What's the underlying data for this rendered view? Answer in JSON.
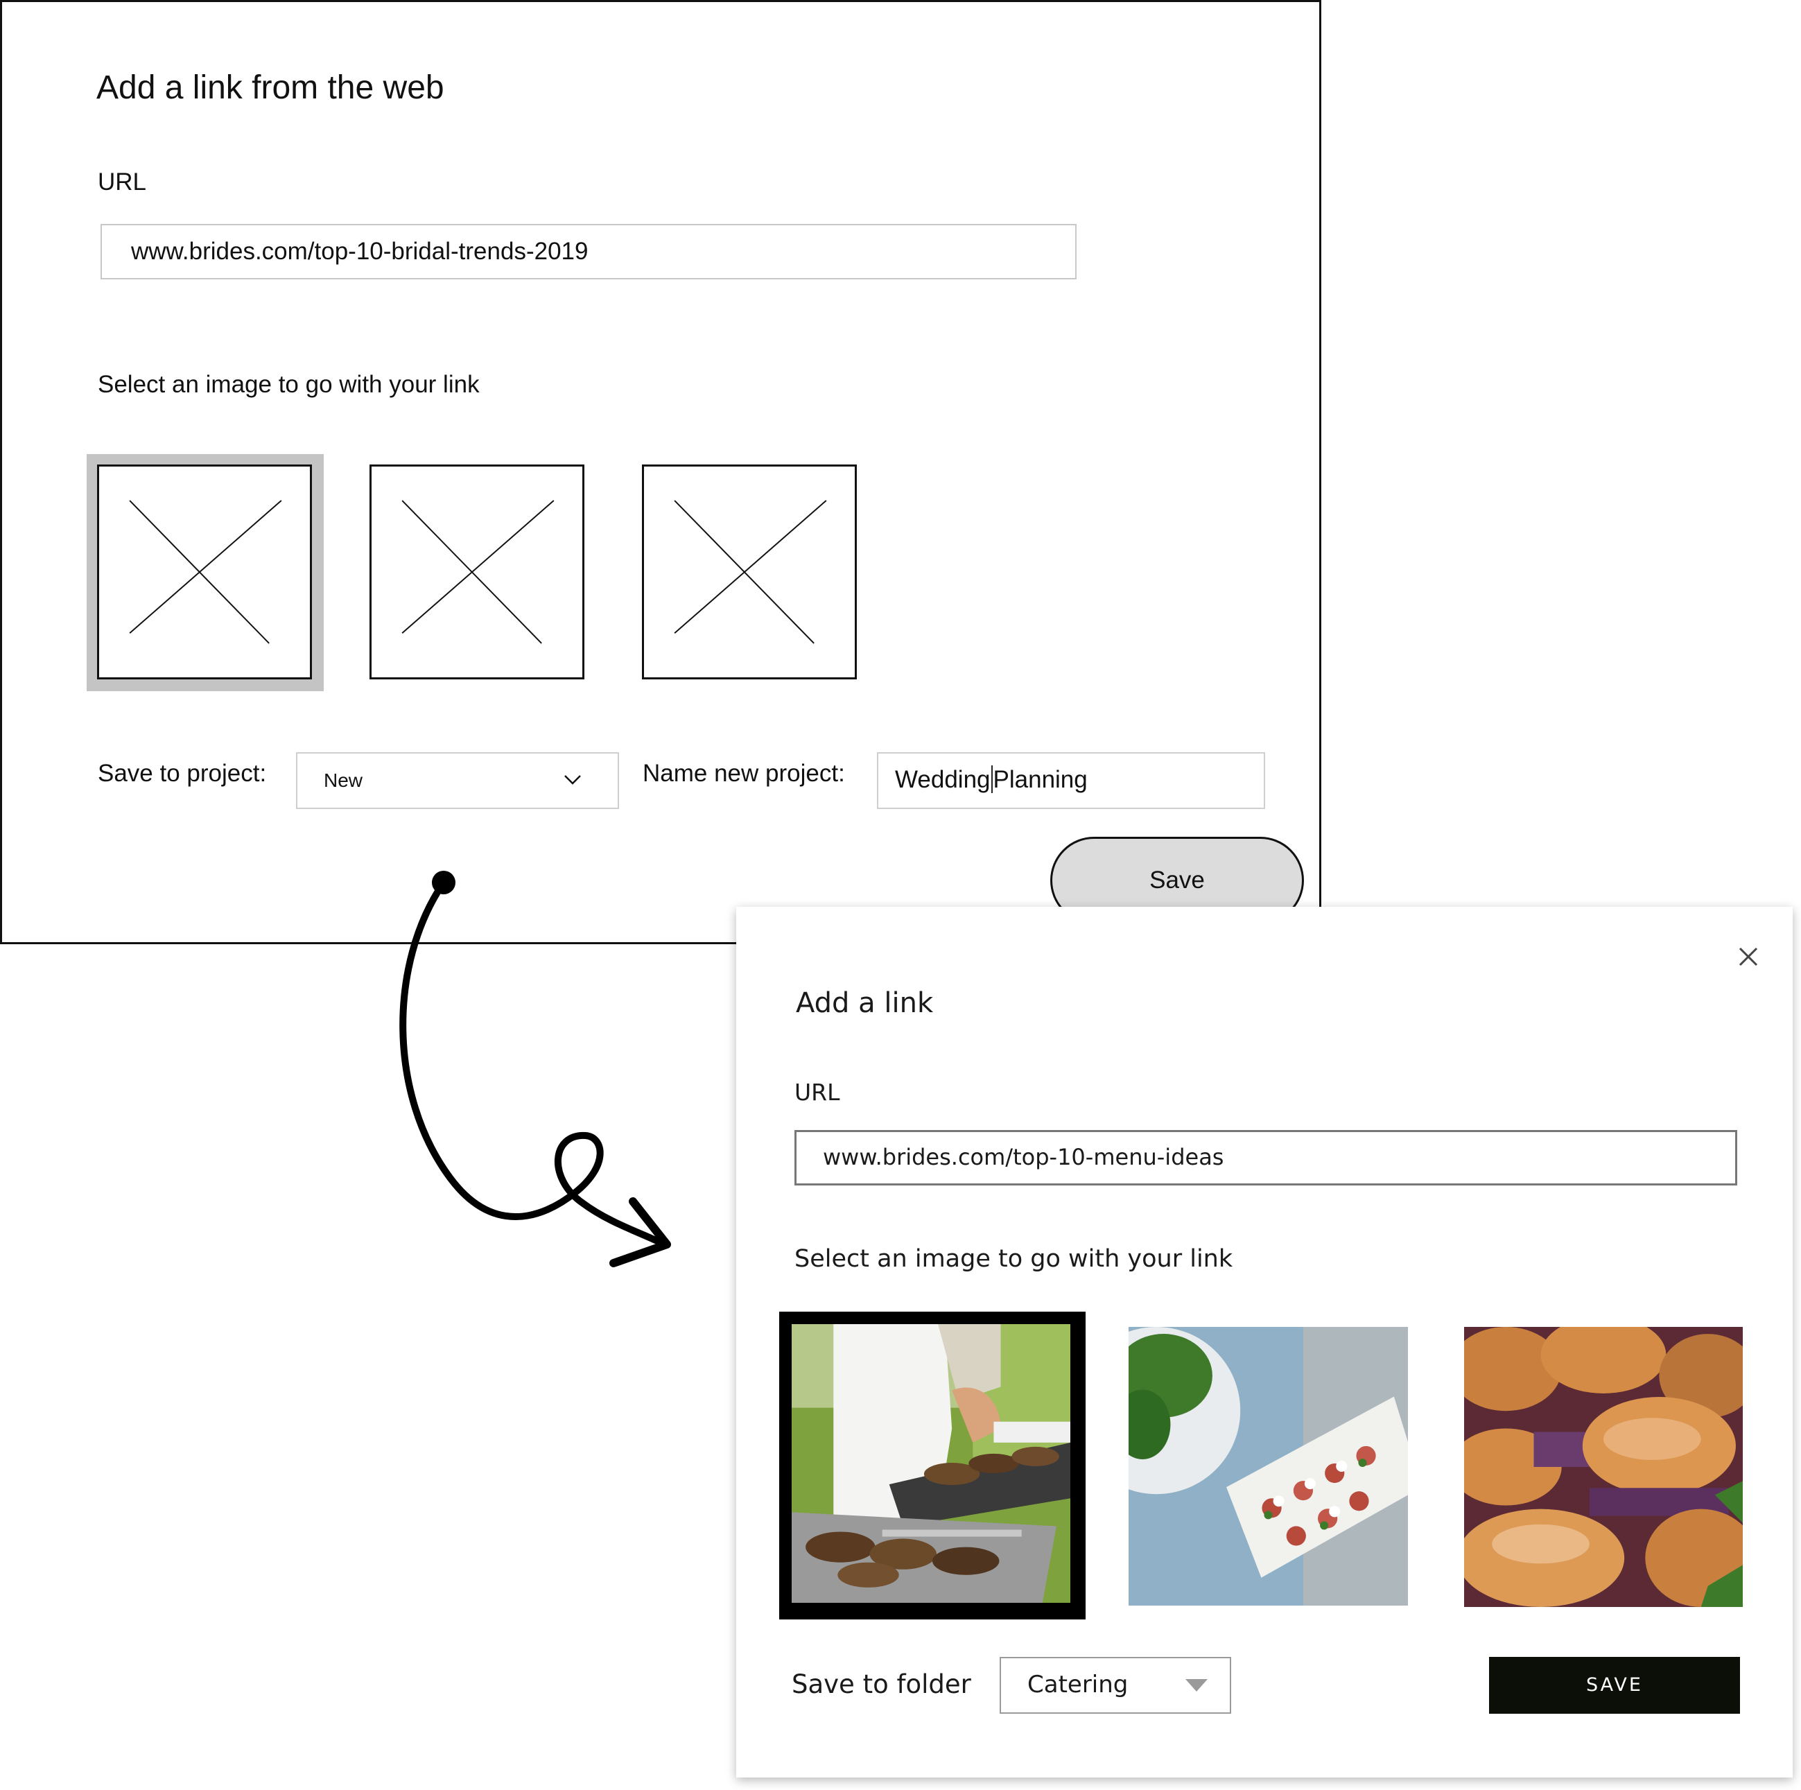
{
  "wireframe": {
    "title": "Add a link from the web",
    "url_label": "URL",
    "url_value": "www.brides.com/top-10-bridal-trends-2019",
    "select_image_label": "Select an image to go with your link",
    "image_placeholders": [
      "placeholder-1",
      "placeholder-2",
      "placeholder-3"
    ],
    "selected_image_index": 0,
    "save_to_project_label": "Save to project:",
    "project_select_value": "New",
    "name_new_project_label": "Name new project:",
    "name_value_before_cursor": "Wedding",
    "name_value_after_cursor": "Planning",
    "save_label": "Save"
  },
  "modal": {
    "title": "Add a link",
    "url_label": "URL",
    "url_value": "www.brides.com/top-10-menu-ideas",
    "select_image_label": "Select an image to go with your link",
    "images": [
      "grilled-meat-tray",
      "appetizer-platter",
      "sliders-burgers"
    ],
    "selected_image_index": 0,
    "save_to_folder_label": "Save to folder",
    "folder_select_value": "Catering",
    "save_label": "SAVE",
    "close_icon": "close-icon"
  },
  "colors": {
    "selected_frame_wire": "#c4c4c4",
    "save_button_modal": "#0b0f07",
    "save_button_wire": "#dcdcdc"
  }
}
